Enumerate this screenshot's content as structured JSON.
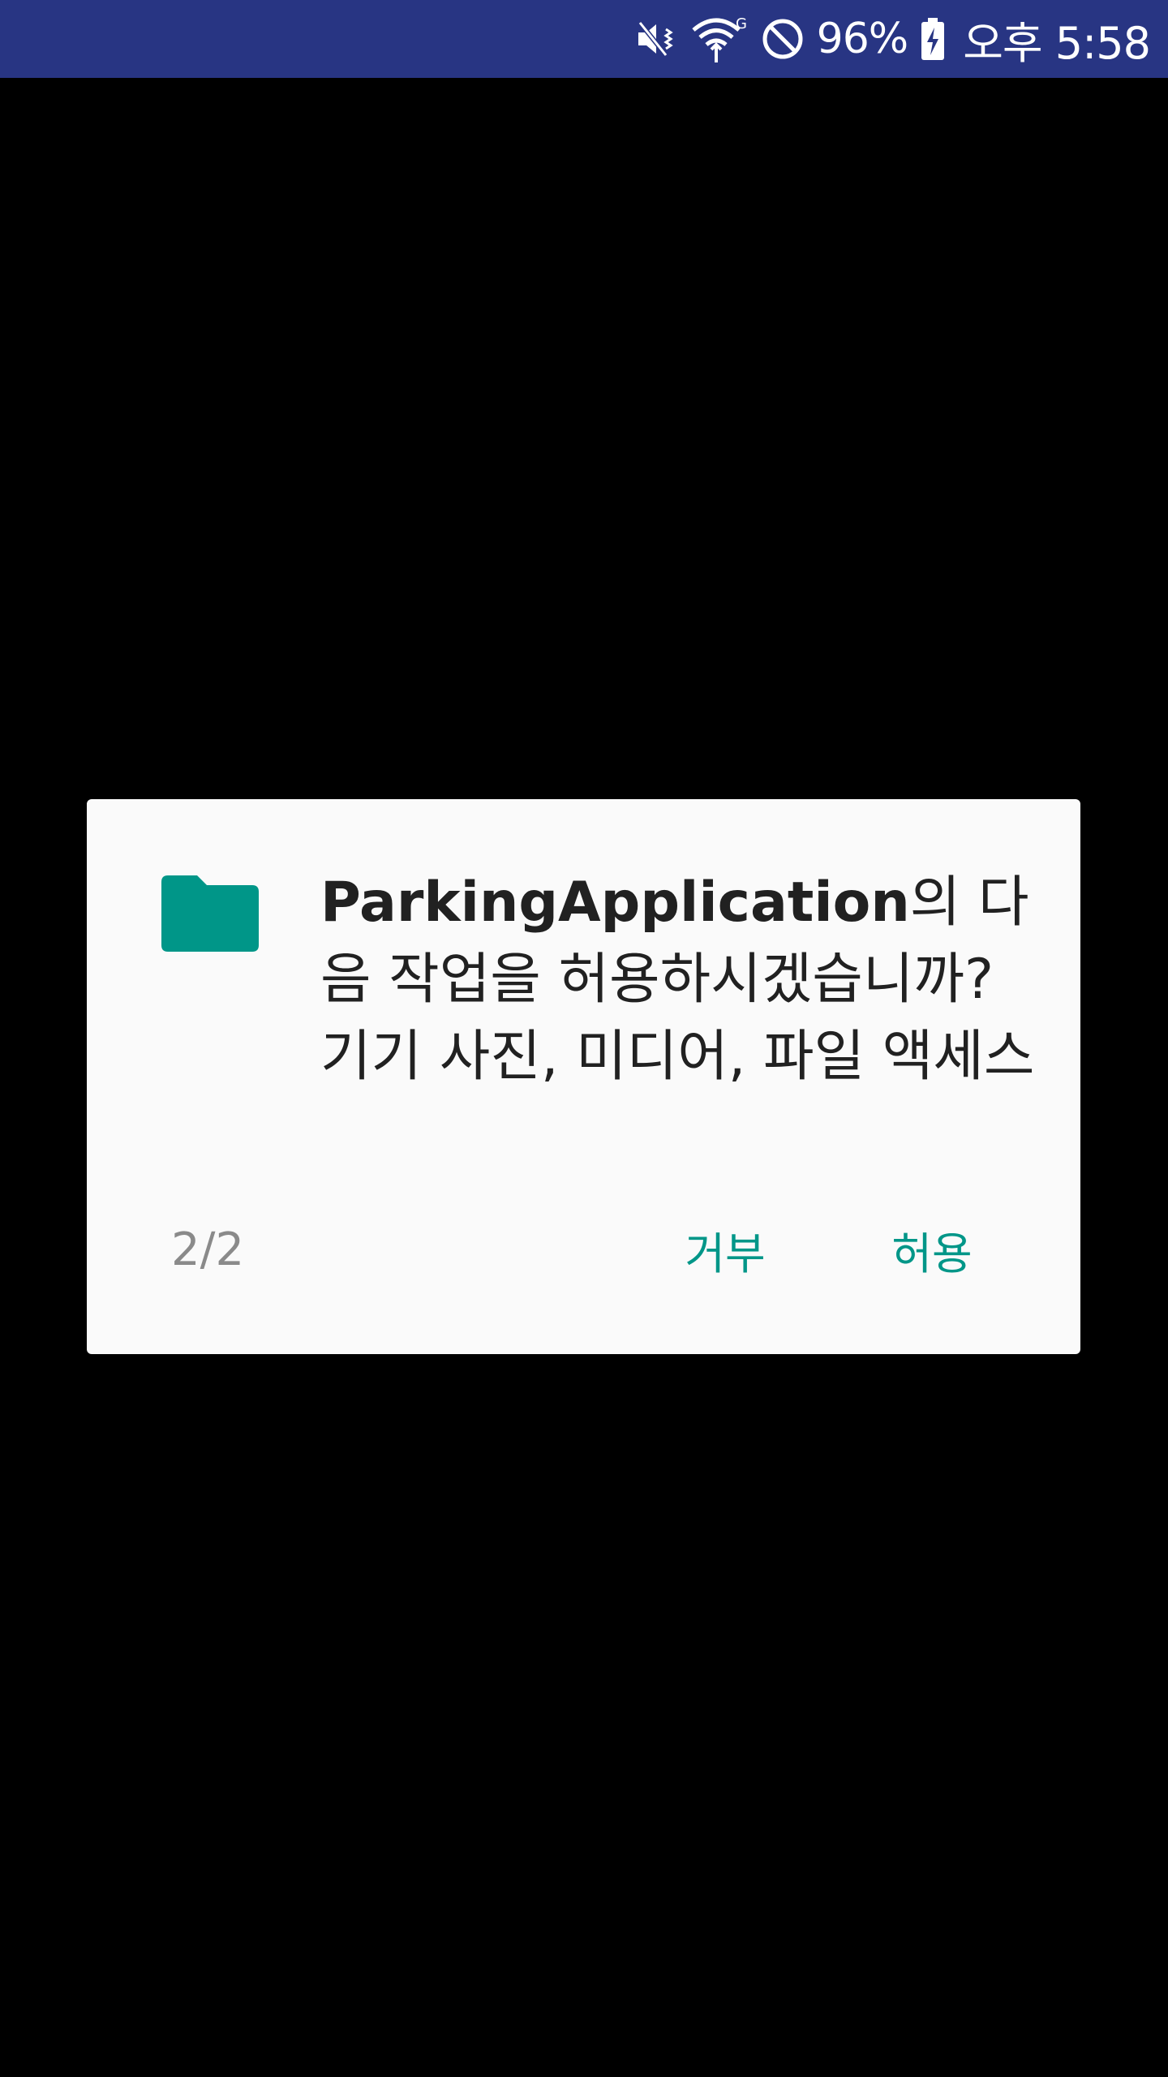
{
  "status_bar": {
    "battery_percent": "96%",
    "time": "오후 5:58",
    "icons": [
      "mute-vibrate-icon",
      "wifi-icon",
      "do-not-disturb-icon",
      "battery-charging-icon"
    ],
    "background_color": "#283583"
  },
  "dialog": {
    "app_name": "ParkingApplication",
    "message_suffix": "의 다음 작업을 허용하시겠습니까? 기기 사진, 미디어, 파일 액세스",
    "icon": "folder-icon",
    "icon_color": "#009688",
    "page_indicator": "2/2",
    "deny_label": "거부",
    "allow_label": "허용",
    "accent_color": "#009688"
  }
}
